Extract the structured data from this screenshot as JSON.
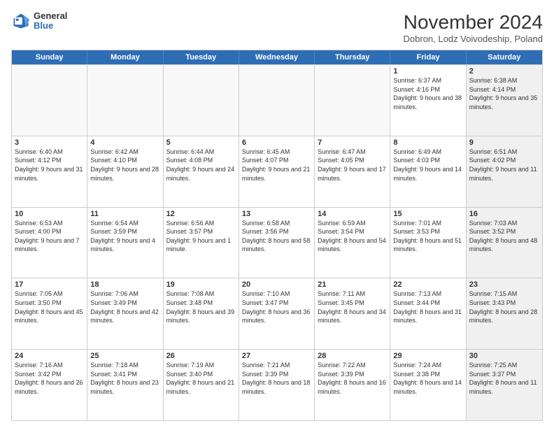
{
  "header": {
    "logo_general": "General",
    "logo_blue": "Blue",
    "title": "November 2024",
    "subtitle": "Dobron, Lodz Voivodeship, Poland"
  },
  "weekdays": [
    "Sunday",
    "Monday",
    "Tuesday",
    "Wednesday",
    "Thursday",
    "Friday",
    "Saturday"
  ],
  "rows": [
    [
      {
        "day": "",
        "info": "",
        "shaded": false,
        "empty": true
      },
      {
        "day": "",
        "info": "",
        "shaded": false,
        "empty": true
      },
      {
        "day": "",
        "info": "",
        "shaded": false,
        "empty": true
      },
      {
        "day": "",
        "info": "",
        "shaded": false,
        "empty": true
      },
      {
        "day": "",
        "info": "",
        "shaded": false,
        "empty": true
      },
      {
        "day": "1",
        "info": "Sunrise: 6:37 AM\nSunset: 4:16 PM\nDaylight: 9 hours and 38 minutes.",
        "shaded": false,
        "empty": false
      },
      {
        "day": "2",
        "info": "Sunrise: 6:38 AM\nSunset: 4:14 PM\nDaylight: 9 hours and 35 minutes.",
        "shaded": true,
        "empty": false
      }
    ],
    [
      {
        "day": "3",
        "info": "Sunrise: 6:40 AM\nSunset: 4:12 PM\nDaylight: 9 hours and 31 minutes.",
        "shaded": false,
        "empty": false
      },
      {
        "day": "4",
        "info": "Sunrise: 6:42 AM\nSunset: 4:10 PM\nDaylight: 9 hours and 28 minutes.",
        "shaded": false,
        "empty": false
      },
      {
        "day": "5",
        "info": "Sunrise: 6:44 AM\nSunset: 4:08 PM\nDaylight: 9 hours and 24 minutes.",
        "shaded": false,
        "empty": false
      },
      {
        "day": "6",
        "info": "Sunrise: 6:45 AM\nSunset: 4:07 PM\nDaylight: 9 hours and 21 minutes.",
        "shaded": false,
        "empty": false
      },
      {
        "day": "7",
        "info": "Sunrise: 6:47 AM\nSunset: 4:05 PM\nDaylight: 9 hours and 17 minutes.",
        "shaded": false,
        "empty": false
      },
      {
        "day": "8",
        "info": "Sunrise: 6:49 AM\nSunset: 4:03 PM\nDaylight: 9 hours and 14 minutes.",
        "shaded": false,
        "empty": false
      },
      {
        "day": "9",
        "info": "Sunrise: 6:51 AM\nSunset: 4:02 PM\nDaylight: 9 hours and 11 minutes.",
        "shaded": true,
        "empty": false
      }
    ],
    [
      {
        "day": "10",
        "info": "Sunrise: 6:53 AM\nSunset: 4:00 PM\nDaylight: 9 hours and 7 minutes.",
        "shaded": false,
        "empty": false
      },
      {
        "day": "11",
        "info": "Sunrise: 6:54 AM\nSunset: 3:59 PM\nDaylight: 9 hours and 4 minutes.",
        "shaded": false,
        "empty": false
      },
      {
        "day": "12",
        "info": "Sunrise: 6:56 AM\nSunset: 3:57 PM\nDaylight: 9 hours and 1 minute.",
        "shaded": false,
        "empty": false
      },
      {
        "day": "13",
        "info": "Sunrise: 6:58 AM\nSunset: 3:56 PM\nDaylight: 8 hours and 58 minutes.",
        "shaded": false,
        "empty": false
      },
      {
        "day": "14",
        "info": "Sunrise: 6:59 AM\nSunset: 3:54 PM\nDaylight: 8 hours and 54 minutes.",
        "shaded": false,
        "empty": false
      },
      {
        "day": "15",
        "info": "Sunrise: 7:01 AM\nSunset: 3:53 PM\nDaylight: 8 hours and 51 minutes.",
        "shaded": false,
        "empty": false
      },
      {
        "day": "16",
        "info": "Sunrise: 7:03 AM\nSunset: 3:52 PM\nDaylight: 8 hours and 48 minutes.",
        "shaded": true,
        "empty": false
      }
    ],
    [
      {
        "day": "17",
        "info": "Sunrise: 7:05 AM\nSunset: 3:50 PM\nDaylight: 8 hours and 45 minutes.",
        "shaded": false,
        "empty": false
      },
      {
        "day": "18",
        "info": "Sunrise: 7:06 AM\nSunset: 3:49 PM\nDaylight: 8 hours and 42 minutes.",
        "shaded": false,
        "empty": false
      },
      {
        "day": "19",
        "info": "Sunrise: 7:08 AM\nSunset: 3:48 PM\nDaylight: 8 hours and 39 minutes.",
        "shaded": false,
        "empty": false
      },
      {
        "day": "20",
        "info": "Sunrise: 7:10 AM\nSunset: 3:47 PM\nDaylight: 8 hours and 36 minutes.",
        "shaded": false,
        "empty": false
      },
      {
        "day": "21",
        "info": "Sunrise: 7:11 AM\nSunset: 3:45 PM\nDaylight: 8 hours and 34 minutes.",
        "shaded": false,
        "empty": false
      },
      {
        "day": "22",
        "info": "Sunrise: 7:13 AM\nSunset: 3:44 PM\nDaylight: 8 hours and 31 minutes.",
        "shaded": false,
        "empty": false
      },
      {
        "day": "23",
        "info": "Sunrise: 7:15 AM\nSunset: 3:43 PM\nDaylight: 8 hours and 28 minutes.",
        "shaded": true,
        "empty": false
      }
    ],
    [
      {
        "day": "24",
        "info": "Sunrise: 7:16 AM\nSunset: 3:42 PM\nDaylight: 8 hours and 26 minutes.",
        "shaded": false,
        "empty": false
      },
      {
        "day": "25",
        "info": "Sunrise: 7:18 AM\nSunset: 3:41 PM\nDaylight: 8 hours and 23 minutes.",
        "shaded": false,
        "empty": false
      },
      {
        "day": "26",
        "info": "Sunrise: 7:19 AM\nSunset: 3:40 PM\nDaylight: 8 hours and 21 minutes.",
        "shaded": false,
        "empty": false
      },
      {
        "day": "27",
        "info": "Sunrise: 7:21 AM\nSunset: 3:39 PM\nDaylight: 8 hours and 18 minutes.",
        "shaded": false,
        "empty": false
      },
      {
        "day": "28",
        "info": "Sunrise: 7:22 AM\nSunset: 3:39 PM\nDaylight: 8 hours and 16 minutes.",
        "shaded": false,
        "empty": false
      },
      {
        "day": "29",
        "info": "Sunrise: 7:24 AM\nSunset: 3:38 PM\nDaylight: 8 hours and 14 minutes.",
        "shaded": false,
        "empty": false
      },
      {
        "day": "30",
        "info": "Sunrise: 7:25 AM\nSunset: 3:37 PM\nDaylight: 8 hours and 11 minutes.",
        "shaded": true,
        "empty": false
      }
    ]
  ]
}
